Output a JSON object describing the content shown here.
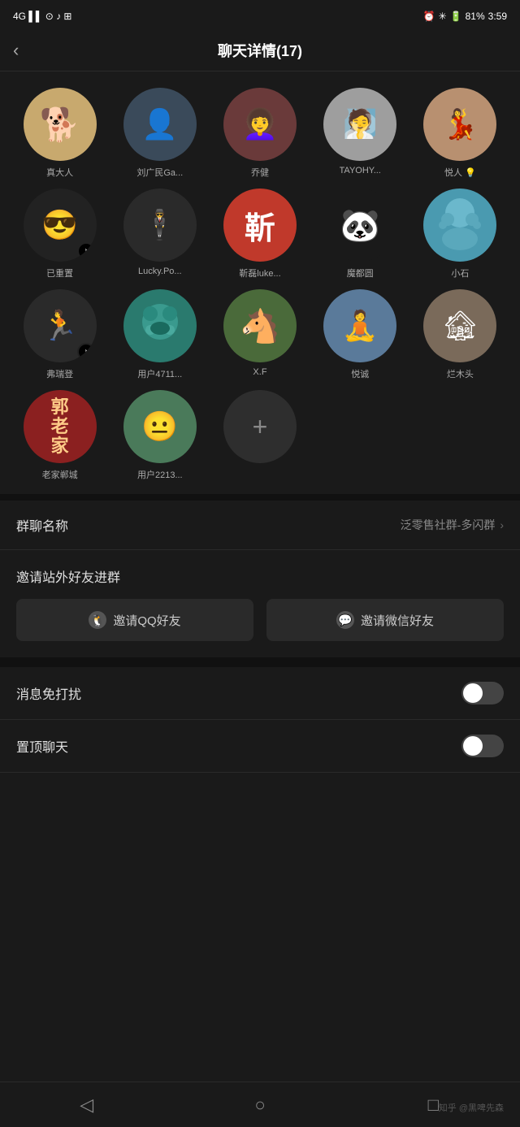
{
  "statusBar": {
    "left": "4G",
    "time": "3:59",
    "battery": "81%"
  },
  "header": {
    "back": "‹",
    "title": "聊天详情(17)"
  },
  "members": [
    {
      "id": 1,
      "name": "真大人",
      "avatarClass": "av-dog",
      "emoji": "🐕",
      "hasTiktok": false
    },
    {
      "id": 2,
      "name": "刘广民Ga...",
      "avatarClass": "av-man",
      "emoji": "👤",
      "hasTiktok": false
    },
    {
      "id": 3,
      "name": "乔健",
      "avatarClass": "av-girl1",
      "emoji": "👩",
      "hasTiktok": false
    },
    {
      "id": 4,
      "name": "TAYOHY...",
      "avatarClass": "av-lady",
      "emoji": "👘",
      "hasTiktok": false
    },
    {
      "id": 5,
      "name": "悦人 💡",
      "avatarClass": "av-woman",
      "emoji": "💃",
      "hasTiktok": false
    },
    {
      "id": 6,
      "name": "已重置",
      "avatarClass": "av-tiktok",
      "emoji": "😎",
      "hasTiktok": true
    },
    {
      "id": 7,
      "name": "Lucky.Po...",
      "avatarClass": "av-lucky",
      "emoji": "🕴",
      "hasTiktok": false
    },
    {
      "id": 8,
      "name": "靳磊luke...",
      "avatarClass": "av-xinlei",
      "emoji": "靳",
      "hasTiktok": false
    },
    {
      "id": 9,
      "name": "魔都圆",
      "avatarClass": "av-bear",
      "emoji": "🐼",
      "hasTiktok": false
    },
    {
      "id": 10,
      "name": "小石",
      "avatarClass": "av-blue",
      "emoji": "👾",
      "hasTiktok": false
    },
    {
      "id": 11,
      "name": "弗瑞登",
      "avatarClass": "av-runner",
      "emoji": "🏃",
      "hasTiktok": true
    },
    {
      "id": 12,
      "name": "用户4711...",
      "avatarClass": "av-monster",
      "emoji": "👾",
      "hasTiktok": false
    },
    {
      "id": 13,
      "name": "X.F",
      "avatarClass": "av-horse",
      "emoji": "🐴",
      "hasTiktok": false
    },
    {
      "id": 14,
      "name": "悦诚",
      "avatarClass": "av-yuecheng",
      "emoji": "🏞",
      "hasTiktok": false
    },
    {
      "id": 15,
      "name": "烂木头",
      "avatarClass": "av-wood",
      "emoji": "🏙",
      "hasTiktok": false
    },
    {
      "id": 16,
      "name": "老家郸城",
      "avatarClass": "av-laojia",
      "emoji": "郭",
      "hasTiktok": false
    },
    {
      "id": 17,
      "name": "用户2213...",
      "avatarClass": "av-user2213",
      "emoji": "😐",
      "hasTiktok": false
    }
  ],
  "addButton": {
    "icon": "+"
  },
  "settings": {
    "groupNameLabel": "群聊名称",
    "groupNameValue": "泛零售社群-多闪群",
    "inviteTitle": "邀请站外好友进群",
    "inviteQQ": "邀请QQ好友",
    "inviteWeChat": "邀请微信好友",
    "muteLabel": "消息免打扰",
    "muteOn": false,
    "pinLabel": "置顶聊天",
    "pinOn": false
  },
  "bottomNav": {
    "back": "◁",
    "home": "○",
    "recent": "□"
  },
  "watermark": "知乎 @黑啤先森"
}
